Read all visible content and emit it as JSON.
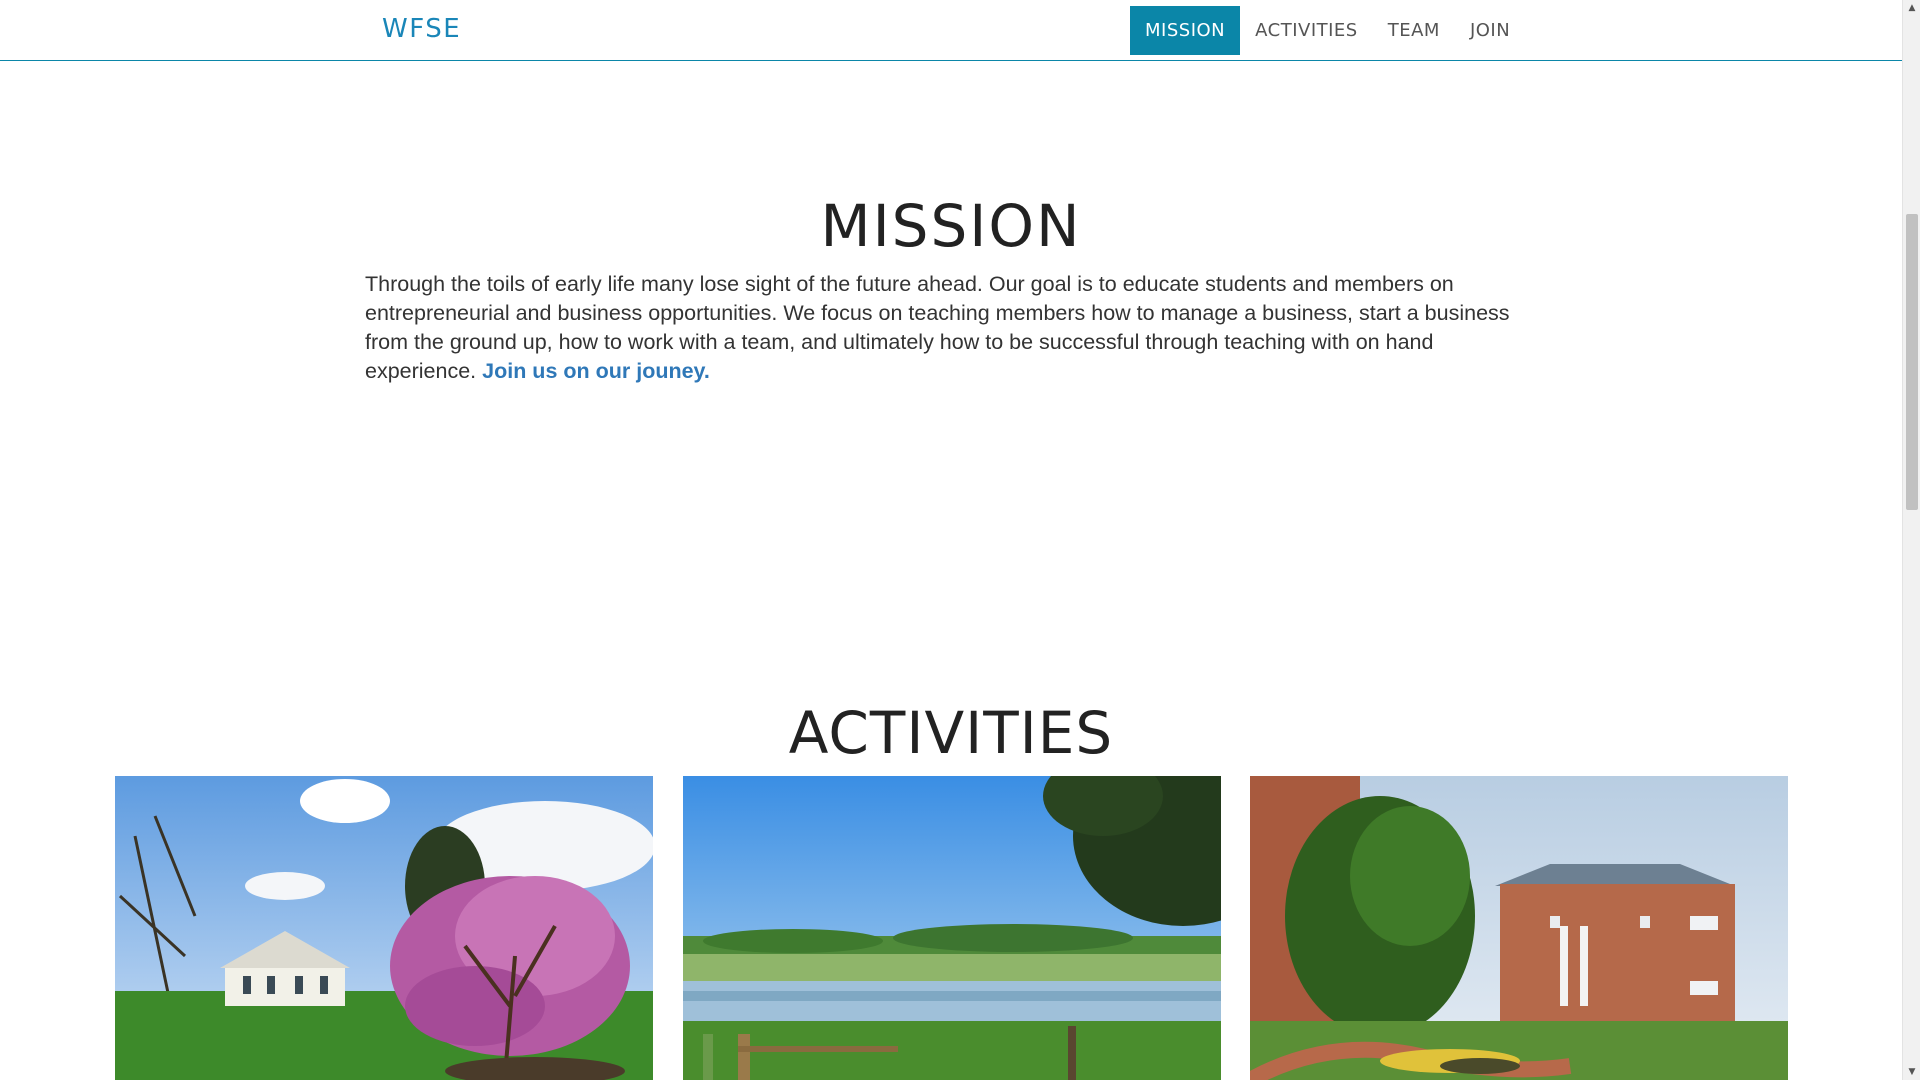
{
  "navbar": {
    "brand": "WFSE",
    "items": [
      {
        "label": "MISSION",
        "active": true
      },
      {
        "label": "ACTIVITIES",
        "active": false
      },
      {
        "label": "TEAM",
        "active": false
      },
      {
        "label": "JOIN",
        "active": false
      }
    ]
  },
  "mission": {
    "title": "MISSION",
    "text": "Through the toils of early life many lose sight of the future ahead. Our goal is to educate students and members on entrepreneurial and business opportunities. We focus on teaching members how to manage a business, start a business from the ground up, how to work with a team, and ultimately how to be successful through teaching with on hand experience. ",
    "link": "Join us on our jouney."
  },
  "activities": {
    "title": "ACTIVITIES",
    "images": [
      {
        "subject": "white house with flowering magnolia tree"
      },
      {
        "subject": "pond in green field with wooden fence"
      },
      {
        "subject": "brick campus building with garden"
      }
    ]
  },
  "colors": {
    "accent": "#0b86a8",
    "brand": "#1a86b8",
    "link": "#2f78b8"
  }
}
